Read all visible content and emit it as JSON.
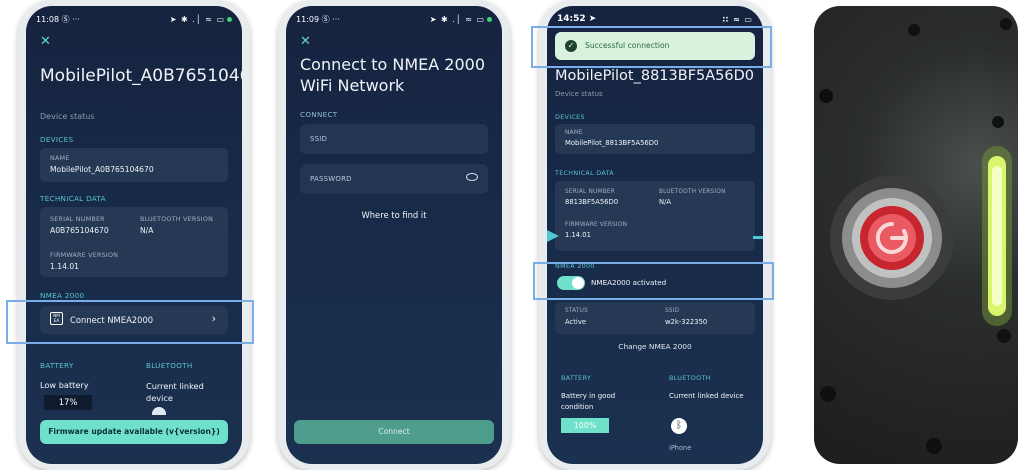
{
  "screen1": {
    "time": "11:08",
    "status_left_icons": "Ⓢ ···",
    "status_right_icons": "➤ ✱ .│ ≈ ▭",
    "close_icon": "close-icon",
    "device_title": "MobilePilot_A0B765104670",
    "device_status": "Device status",
    "devices_header": "DEVICES",
    "name_label": "NAME",
    "name_value": "MobilePilot_A0B765104670",
    "tech_header": "TECHNICAL DATA",
    "serial_label": "SERIAL NUMBER",
    "serial_value": "A0B765104670",
    "bt_version_label": "BLUETOOTH VERSION",
    "bt_version_value": "N/A",
    "fw_label": "FIRMWARE VERSION",
    "fw_value": "1.14.01",
    "nmea_header": "NMEA 2000",
    "connect_nmea": "Connect NMEA2000",
    "battery_header": "BATTERY",
    "bluetooth_header": "BLUETOOTH",
    "battery_text": "Low battery",
    "battery_percent": "17%",
    "bluetooth_text": "Current linked device",
    "firmware_update": "Firmware update available (v{version})"
  },
  "screen2": {
    "time": "11:09",
    "status_left_icons": "Ⓢ ···",
    "status_right_icons": "➤ ✱ .│ ≈ ▭",
    "title": "Connect to NMEA 2000 WiFi Network",
    "connect_header": "CONNECT",
    "ssid_placeholder": "SSID",
    "password_placeholder": "PASSWORD",
    "where_to_find": "Where to find it",
    "connect_button": "Connect"
  },
  "screen3": {
    "time": "14:52",
    "toast": "Successful connection",
    "device_title": "MobilePilot_8813BF5A56D0",
    "device_status": "Device status",
    "devices_header": "DEVICES",
    "name_label": "NAME",
    "name_value": "MobilePilot_8813BF5A56D0",
    "tech_header": "TECHNICAL DATA",
    "serial_label": "SERIAL NUMBER",
    "serial_value": "8813BF5A56D0",
    "bt_version_label": "BLUETOOTH VERSION",
    "bt_version_value": "N/A",
    "fw_label": "FIRMWARE VERSION",
    "fw_value": "1.14.01",
    "nmea_header": "NMEA 2000",
    "nmea_activated": "NMEA2000 activated",
    "status_label": "STATUS",
    "status_value": "Active",
    "ssid_label": "SSID",
    "ssid_value": "w2k-322350",
    "change_nmea": "Change NMEA 2000",
    "battery_header": "BATTERY",
    "bluetooth_header": "BLUETOOTH",
    "battery_text": "Battery in good condition",
    "battery_percent": "100%",
    "bluetooth_text": "Current linked device",
    "iphone_text": "iPhone"
  },
  "colors": {
    "accent": "#6fe0c9",
    "section": "#56c3d2",
    "highlight": "#7aaee8",
    "bg": "#16233f"
  }
}
